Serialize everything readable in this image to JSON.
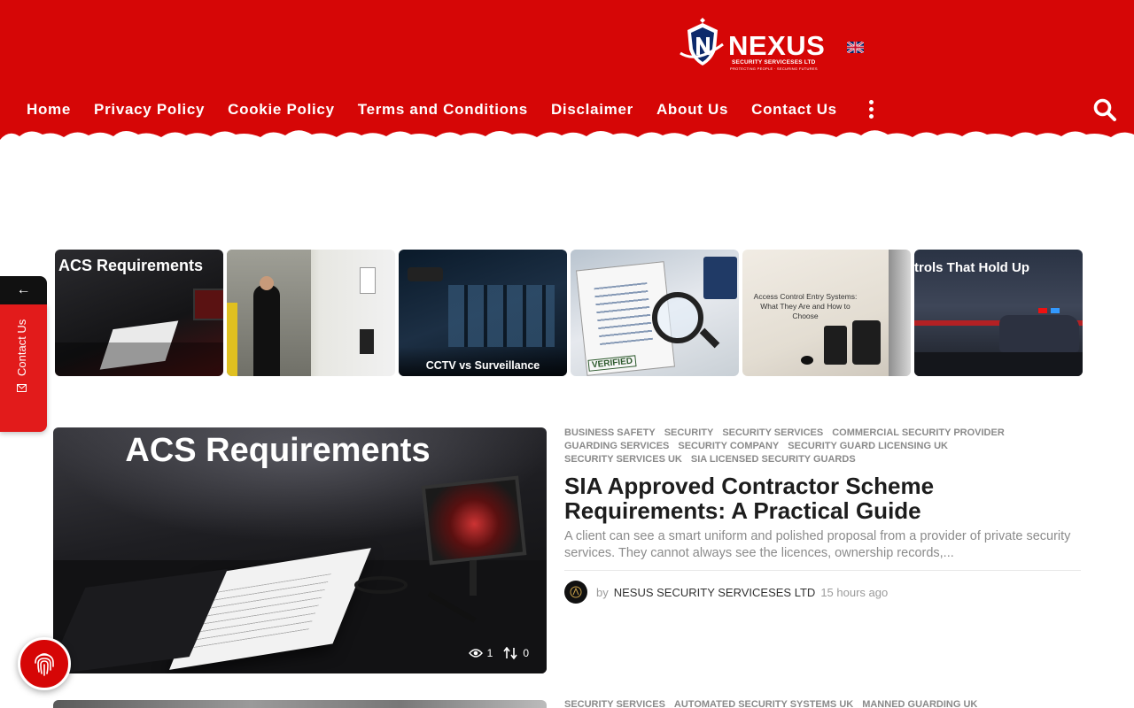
{
  "header": {
    "logo_word": "NEXUS",
    "logo_sub": "SECURITY SERVICESES LTD",
    "logo_tagline": "PROTECTING PEOPLE · SECURING FUTURES",
    "brand_color": "#d60606"
  },
  "nav": {
    "items": [
      {
        "label": "Home"
      },
      {
        "label": "Privacy Policy"
      },
      {
        "label": "Cookie Policy"
      },
      {
        "label": "Terms and Conditions"
      },
      {
        "label": "Disclaimer"
      },
      {
        "label": "About Us"
      },
      {
        "label": "Contact Us"
      }
    ],
    "more_icon": "vertical-dots-icon",
    "search_icon": "search-icon"
  },
  "side_tab": {
    "arrow": "←",
    "label": "Contact Us",
    "icon": "mail-icon"
  },
  "thumbnails": [
    {
      "caption": "ACS Requirements"
    },
    {
      "caption": ""
    },
    {
      "caption": "CCTV vs Surveillance"
    },
    {
      "caption": "VERIFIED"
    },
    {
      "caption": "Access Control Entry Systems: What They Are and How to Choose"
    },
    {
      "caption": "trols That Hold Up"
    }
  ],
  "featured": {
    "image_title": "ACS Requirements",
    "views": "1",
    "shares": "0",
    "tags_rows": [
      [
        "BUSINESS SAFETY",
        "SECURITY",
        "SECURITY SERVICES",
        "COMMERCIAL SECURITY PROVIDER"
      ],
      [
        "GUARDING SERVICES",
        "SECURITY COMPANY",
        "SECURITY GUARD LICENSING UK"
      ],
      [
        "SECURITY SERVICES UK",
        "SIA LICENSED SECURITY GUARDS"
      ]
    ],
    "headline": "SIA Approved Contractor Scheme Requirements: A Practical Guide",
    "excerpt": "A client can see a smart uniform and polished proposal from a provider of private security services. They cannot always see the licences, ownership records,...",
    "by": "by",
    "author": "NESUS SECURITY SERVICESES LTD",
    "time": "15 hours ago"
  },
  "second": {
    "tags": [
      "SECURITY SERVICES",
      "AUTOMATED SECURITY SYSTEMS UK",
      "MANNED GUARDING UK"
    ]
  }
}
